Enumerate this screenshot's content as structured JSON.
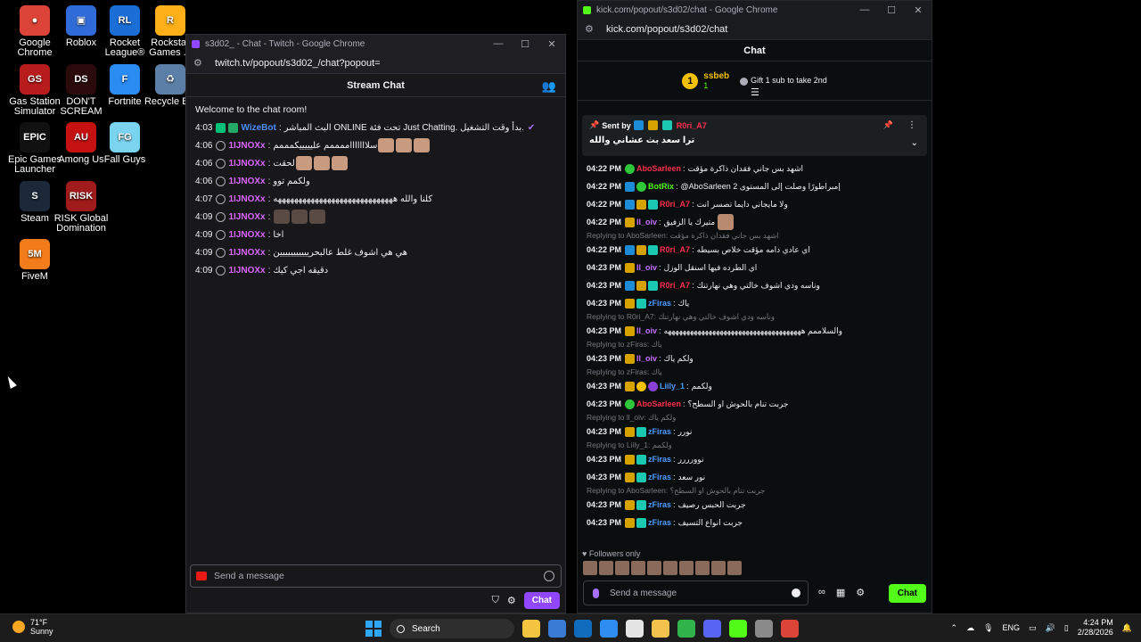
{
  "desktop": {
    "icons": [
      {
        "label": "Google Chrome",
        "color": "#db4437",
        "glyph": "●"
      },
      {
        "label": "Roblox",
        "color": "#2f6cd8",
        "glyph": "▣"
      },
      {
        "label": "Rocket League®",
        "color": "#1b6ed6",
        "glyph": "RL"
      },
      {
        "label": "Rockstar Games ...",
        "color": "#fcaf17",
        "glyph": "R"
      },
      {
        "label": "Gas Station Simulator",
        "color": "#b91c1c",
        "glyph": "GS"
      },
      {
        "label": "DON'T SCREAM",
        "color": "#2a0a0a",
        "glyph": "DS"
      },
      {
        "label": "Fortnite",
        "color": "#2a8bf2",
        "glyph": "F"
      },
      {
        "label": "Recycle Bin",
        "color": "#5b7fa6",
        "glyph": "♻"
      },
      {
        "label": "Epic Games Launcher",
        "color": "#111111",
        "glyph": "EPIC"
      },
      {
        "label": "Among Us",
        "color": "#c51111",
        "glyph": "AU"
      },
      {
        "label": "Fall Guys",
        "color": "#7ad4f0",
        "glyph": "FG"
      },
      {
        "label": "Steam",
        "color": "#1b2838",
        "glyph": "S"
      },
      {
        "label": "RISK Global Domination",
        "color": "#a01b1b",
        "glyph": "RISK"
      },
      {
        "label": "FiveM",
        "color": "#f27b1a",
        "glyph": "5M"
      }
    ]
  },
  "twitch": {
    "window_title": "s3d02_ - Chat - Twitch - Google Chrome",
    "url": "twitch.tv/popout/s3d02_/chat?popout=",
    "header": "Stream Chat",
    "welcome": "Welcome to the chat room!",
    "messages": [
      {
        "time": "4:03",
        "user": "WizeBot",
        "color": "#4c8cff",
        "text": "البث المباشر ONLINE تحت فئة Just Chatting. بدأ وقت التشغيل."
      },
      {
        "time": "4:06",
        "user": "1IJNOXx",
        "color": "#d966ff",
        "text": "سلاااااااممممم عليييييكمممم"
      },
      {
        "time": "4:06",
        "user": "1IJNOXx",
        "color": "#d966ff",
        "text": "لحقت"
      },
      {
        "time": "4:06",
        "user": "1IJNOXx",
        "color": "#d966ff",
        "text": "ولكمم توو"
      },
      {
        "time": "4:07",
        "user": "1IJNOXx",
        "color": "#d966ff",
        "text": "كلنا والله هههههههههههههههههههههههههههههه"
      },
      {
        "time": "4:09",
        "user": "1IJNOXx",
        "color": "#d966ff",
        "text": ""
      },
      {
        "time": "4:09",
        "user": "1IJNOXx",
        "color": "#d966ff",
        "text": "اخا"
      },
      {
        "time": "4:09",
        "user": "1IJNOXx",
        "color": "#d966ff",
        "text": "هي هي اشوف غلط عالبحرييييييييييين"
      },
      {
        "time": "4:09",
        "user": "1IJNOXx",
        "color": "#d966ff",
        "text": "دقيقه اجي كيك"
      }
    ],
    "input_placeholder": "Send a message",
    "chat_button": "Chat"
  },
  "kick": {
    "window_title": "kick.com/popout/s3d02/chat - Google Chrome",
    "url": "kick.com/popout/s3d02/chat",
    "header": "Chat",
    "leader": {
      "rank": "1",
      "name": "ssbeb",
      "count": "1",
      "gift_text": "Gift 1 sub to take 2nd"
    },
    "pinned": {
      "sent_by": "Sent by",
      "user": "R0ri_A7",
      "text": "ترا سعد بث عشاني والله"
    },
    "messages": [
      {
        "reply": "",
        "time": "04:22 PM",
        "badges": [
          "green"
        ],
        "user": "AboSarleen",
        "color": "#ff2e4d",
        "text": "اشهد بس جاني فقدان ذاكرة مؤقت"
      },
      {
        "reply": "",
        "time": "04:22 PM",
        "badges": [
          "blue",
          "green"
        ],
        "user": "BotRix",
        "color": "#53fc18",
        "text": "@AboSarleen 2 إمبراطورًا وصلت إلى المستوى"
      },
      {
        "reply": "",
        "time": "04:22 PM",
        "badges": [
          "blue",
          "crown",
          "teal"
        ],
        "user": "R0ri_A7",
        "color": "#ff2e4d",
        "text": "ولا مايجاني دايما تصسر انت"
      },
      {
        "reply": "",
        "time": "04:22 PM",
        "badges": [
          "crown"
        ],
        "user": "ll_oiv",
        "color": "#c56fff",
        "text": "متيرك يا الزفيق"
      },
      {
        "reply": "Replying to AboSarleen: اشهد بس جاني فقدان ذاكرة مؤقت",
        "time": "04:22 PM",
        "badges": [
          "blue",
          "crown",
          "teal"
        ],
        "user": "R0ri_A7",
        "color": "#ff2e4d",
        "text": "اي عادي دامه مؤقت خلاص بسيطه"
      },
      {
        "reply": "",
        "time": "04:23 PM",
        "badges": [
          "crown"
        ],
        "user": "ll_oiv",
        "color": "#c56fff",
        "text": "اي الطرده فيها اسنقل الوزل"
      },
      {
        "reply": "",
        "time": "04:23 PM",
        "badges": [
          "blue",
          "crown",
          "teal"
        ],
        "user": "R0ri_A7",
        "color": "#ff2e4d",
        "text": "وناسه ودي اشوف خالتي وهي نهارتنك"
      },
      {
        "reply": "",
        "time": "04:23 PM",
        "badges": [
          "crown",
          "teal"
        ],
        "user": "zFiras",
        "color": "#4c9bff",
        "text": "ياك"
      },
      {
        "reply": "Replying to R0ri_A7: وناسه ودي اشوف خالتي وهي نهارتنك",
        "time": "04:23 PM",
        "badges": [
          "crown"
        ],
        "user": "ll_oiv",
        "color": "#c56fff",
        "text": "والسلاممم هههههههههههههههههههههههههههههههههههههه"
      },
      {
        "reply": "Replying to zFiras: ياك",
        "time": "04:23 PM",
        "badges": [
          "crown"
        ],
        "user": "ll_oiv",
        "color": "#c56fff",
        "text": "ولكم ياك"
      },
      {
        "reply": "Replying to zFiras: ياك",
        "time": "04:23 PM",
        "badges": [
          "crown",
          "gold",
          "pink"
        ],
        "user": "Liily_1",
        "color": "#4c9bff",
        "text": "ولكمم"
      },
      {
        "reply": "",
        "time": "04:23 PM",
        "badges": [
          "green"
        ],
        "user": "AboSarleen",
        "color": "#ff2e4d",
        "text": "جربت تنام بالحوش او السطح؟"
      },
      {
        "reply": "Replying to ll_oiv: ولكم ياك",
        "time": "04:23 PM",
        "badges": [
          "crown",
          "teal"
        ],
        "user": "zFiras",
        "color": "#4c9bff",
        "text": "نورر"
      },
      {
        "reply": "Replying to Liily_1: ولكمم",
        "time": "04:23 PM",
        "badges": [
          "crown",
          "teal"
        ],
        "user": "zFiras",
        "color": "#4c9bff",
        "text": "نوورررر"
      },
      {
        "reply": "",
        "time": "04:23 PM",
        "badges": [
          "crown",
          "teal"
        ],
        "user": "zFiras",
        "color": "#4c9bff",
        "text": "نور سعد"
      },
      {
        "reply": "Replying to AboSarleen: جربت تنام بالحوش او السطح؟",
        "time": "04:23 PM",
        "badges": [
          "crown",
          "teal"
        ],
        "user": "zFiras",
        "color": "#4c9bff",
        "text": "جربت الحبس رصيف"
      },
      {
        "reply": "",
        "time": "04:23 PM",
        "badges": [
          "crown",
          "teal"
        ],
        "user": "zFiras",
        "color": "#4c9bff",
        "text": "جربت انواع التسيف"
      }
    ],
    "followers_only": "Followers only",
    "input_placeholder": "Send a message",
    "chat_button": "Chat"
  },
  "taskbar": {
    "weather_temp": "71°F",
    "weather_desc": "Sunny",
    "search_label": "Search",
    "apps": [
      "#f5c542",
      "#3a7bd5",
      "#0f6cbd",
      "#2f8cf0",
      "#e5e5e5",
      "#f2c14e",
      "#2fb34a",
      "#5865f2",
      "#53fc18",
      "#8a8a8a",
      "#db4437"
    ],
    "lang": "ENG",
    "time": "4:24 PM",
    "date": "2/28/2026"
  }
}
